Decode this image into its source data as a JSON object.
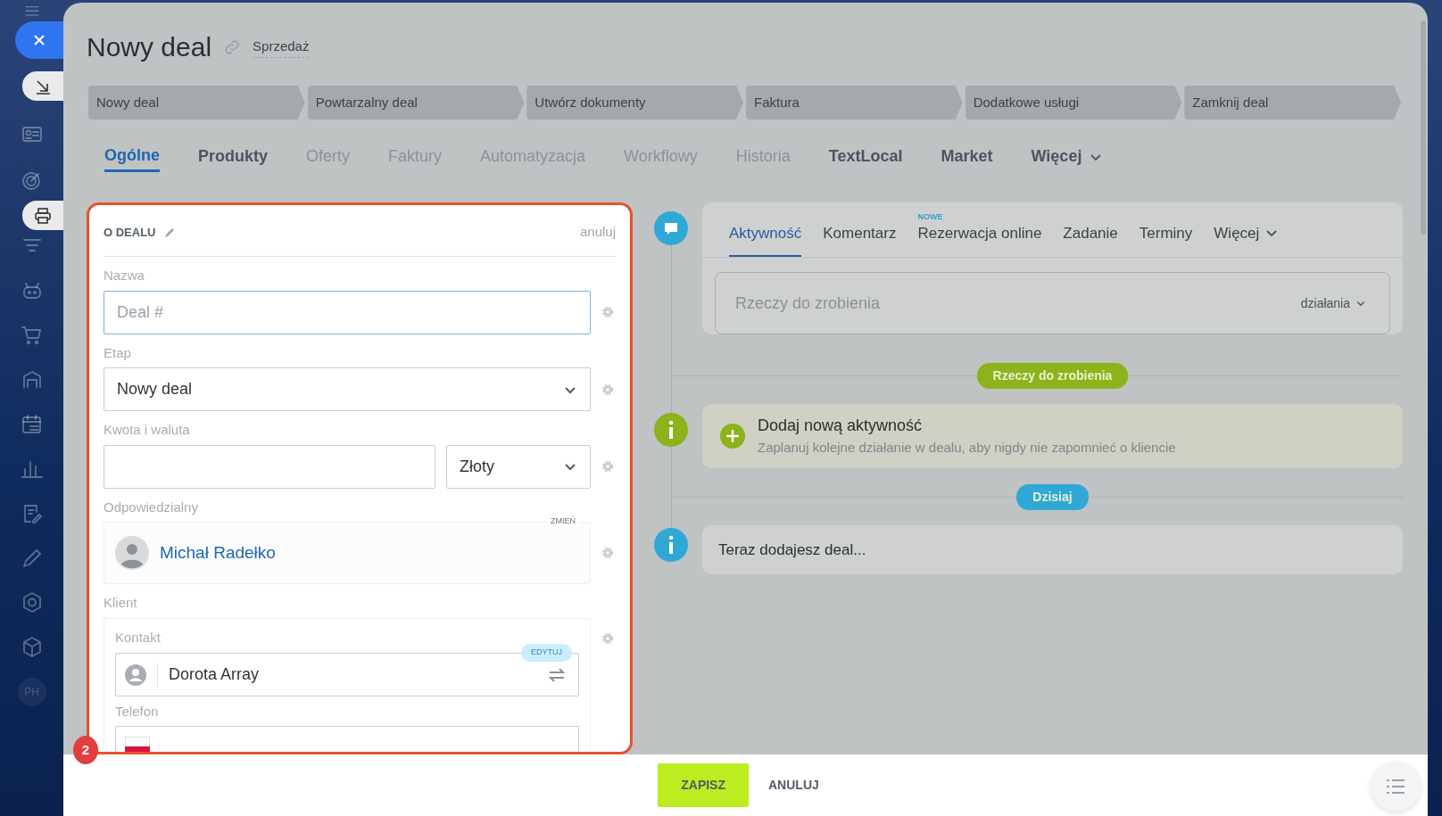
{
  "sidebar": {
    "avatar_initials": "PH"
  },
  "header": {
    "title": "Nowy deal",
    "category": "Sprzedaż"
  },
  "stages": [
    {
      "label": "Nowy deal"
    },
    {
      "label": "Powtarzalny deal"
    },
    {
      "label": "Utwórz dokumenty"
    },
    {
      "label": "Faktura"
    },
    {
      "label": "Dodatkowe usługi"
    },
    {
      "label": "Zamknij deal"
    }
  ],
  "tabs": [
    {
      "label": "Ogólne",
      "selected": true,
      "disabled": false
    },
    {
      "label": "Produkty",
      "selected": false,
      "disabled": false
    },
    {
      "label": "Oferty",
      "selected": false,
      "disabled": true
    },
    {
      "label": "Faktury",
      "selected": false,
      "disabled": true
    },
    {
      "label": "Automatyzacja",
      "selected": false,
      "disabled": true
    },
    {
      "label": "Workflowy",
      "selected": false,
      "disabled": true
    },
    {
      "label": "Historia",
      "selected": false,
      "disabled": true
    },
    {
      "label": "TextLocal",
      "selected": false,
      "disabled": false
    },
    {
      "label": "Market",
      "selected": false,
      "disabled": false
    },
    {
      "label": "Więcej",
      "selected": false,
      "disabled": false,
      "dropdown": true
    }
  ],
  "form": {
    "title": "O DEALU",
    "cancel": "anuluj",
    "step_badge": "2",
    "fields": [
      {
        "kind": "text",
        "label": "Nazwa",
        "placeholder": "Deal #"
      },
      {
        "kind": "select",
        "label": "Etap",
        "value": "Nowy deal"
      },
      {
        "kind": "money",
        "label": "Kwota i waluta",
        "currency": "Złoty"
      },
      {
        "kind": "user",
        "label": "Odpowiedzialny",
        "action": "ZMIEŃ",
        "name": "Michał Radełko"
      },
      {
        "kind": "client",
        "label": "Klient",
        "sublabel": "Kontakt",
        "action": "EDYTUJ",
        "value": "Dorota Array",
        "phone_label": "Telefon"
      }
    ]
  },
  "timeline": {
    "tabs": [
      {
        "label": "Aktywność",
        "selected": true
      },
      {
        "label": "Komentarz",
        "selected": false
      },
      {
        "label": "Rezerwacja online",
        "selected": false,
        "badge": "NOWE"
      },
      {
        "label": "Zadanie",
        "selected": false
      },
      {
        "label": "Terminy",
        "selected": false
      },
      {
        "label": "Więcej",
        "selected": false,
        "dropdown": true
      }
    ],
    "placeholder": "Rzeczy do zrobienia",
    "actions": "działania",
    "items": [
      {
        "kind": "separator",
        "label": "Rzeczy do zrobienia",
        "color": "#8cb31a"
      },
      {
        "kind": "add",
        "title": "Dodaj nową aktywność",
        "text": "Zaplanuj kolejne działanie w dealu, aby nigdy nie zapomnieć o kliencie"
      },
      {
        "kind": "separator",
        "label": "Dzisiaj",
        "color": "#2fa8d6"
      },
      {
        "kind": "info",
        "text": "Teraz dodajesz deal..."
      }
    ]
  },
  "footer": {
    "save": "ZAPISZ",
    "cancel": "ANULUJ"
  }
}
